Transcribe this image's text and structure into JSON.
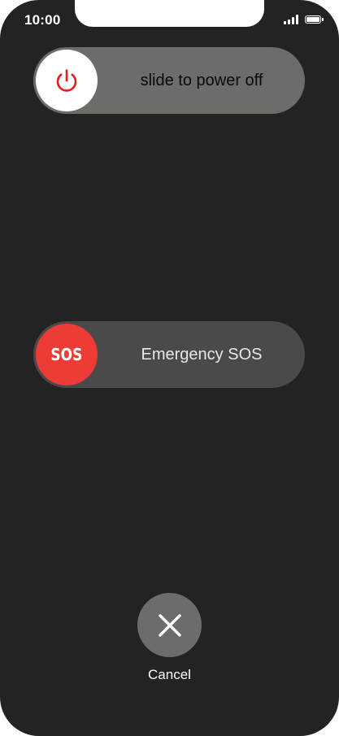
{
  "status_bar": {
    "time": "10:00",
    "icons": [
      "signal-bars-icon",
      "battery-icon"
    ]
  },
  "power_slider": {
    "label": "slide to power off",
    "icon": "power-icon",
    "icon_color": "#e0201a"
  },
  "sos_slider": {
    "label": "Emergency SOS",
    "knob_text": "SOS",
    "knob_color": "#ee3b35"
  },
  "cancel": {
    "label": "Cancel",
    "icon": "close-icon"
  }
}
